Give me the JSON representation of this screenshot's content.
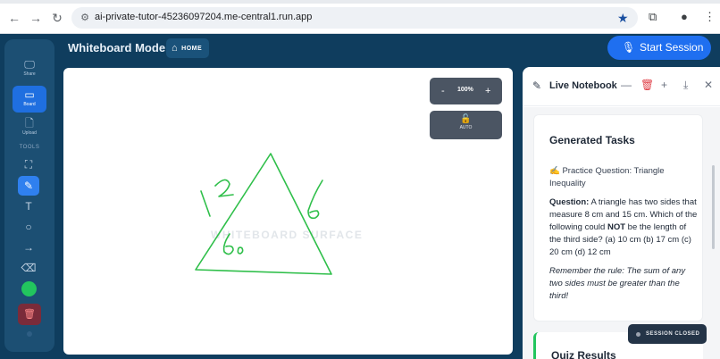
{
  "browser": {
    "url": "ai-private-tutor-45236097204.me-central1.run.app"
  },
  "sidebar": {
    "items": [
      {
        "label": "Share",
        "icon": "monitor-icon"
      },
      {
        "label": "Board",
        "icon": "board-icon"
      },
      {
        "label": "Upload",
        "icon": "file-icon"
      }
    ],
    "tools_label": "TOOLS",
    "active_color": "#22c55e"
  },
  "header": {
    "title": "Whiteboard Mode",
    "home_label": "HOME",
    "start_session_label": "Start Session"
  },
  "board": {
    "zoom_minus": "-",
    "zoom_value": "100%",
    "zoom_plus": "+",
    "auto_label": "AUTO",
    "watermark": "WHITEBOARD SURFACE",
    "sketch_color": "#2fbf4a"
  },
  "notebook": {
    "title": "Live Notebook",
    "section_title": "Generated Tasks",
    "task_title": "✍️ Practice Question: Triangle Inequality",
    "question_label": "Question:",
    "question_part1": " A triangle has two sides that measure 8 cm and 15 cm. Which of the following could ",
    "question_bold": "NOT",
    "question_part2": " be the length of the third side? (a) 10 cm (b) 17 cm (c) 20 cm (d) 12 cm",
    "rule": "Remember the rule: The sum of any two sides must be greater than the third!",
    "next_section": "Quiz Results"
  },
  "status": {
    "session_closed": "SESSION CLOSED"
  }
}
